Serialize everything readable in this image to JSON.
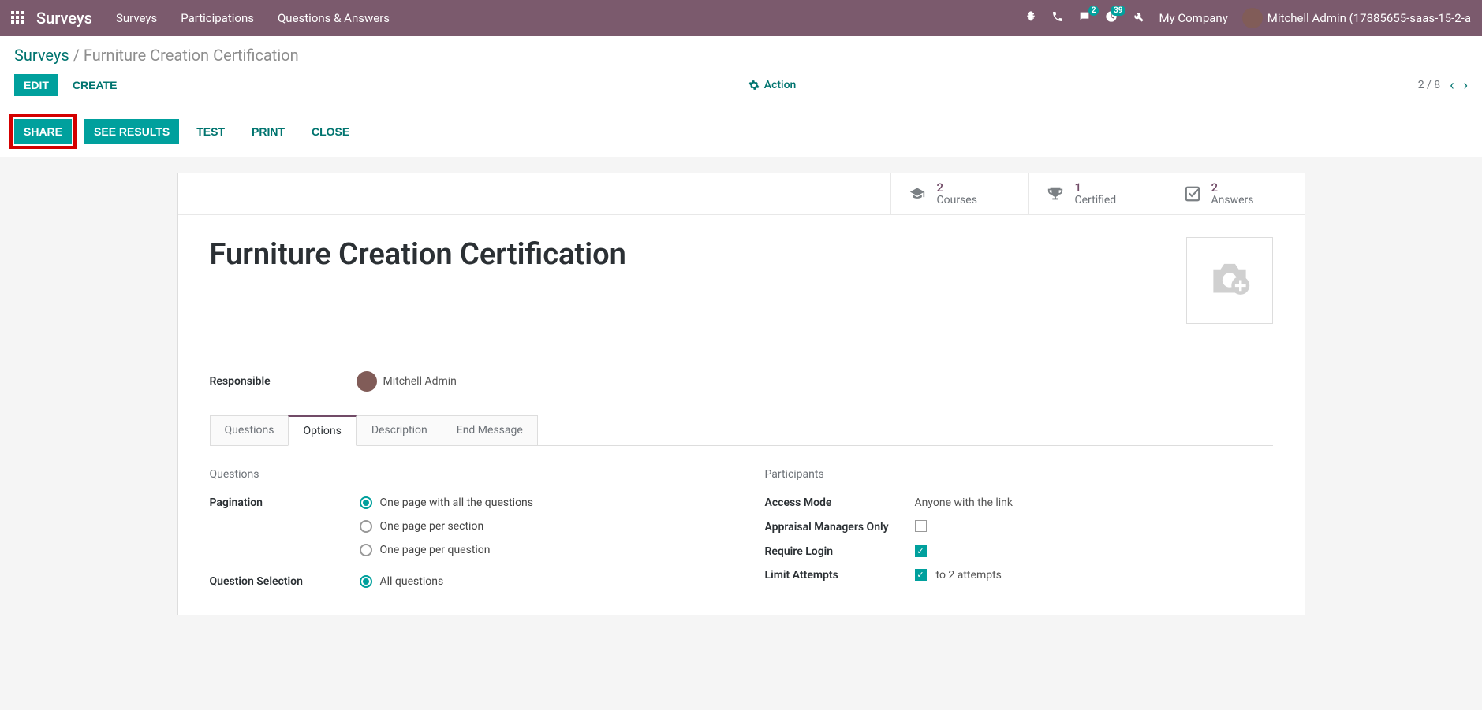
{
  "topnav": {
    "brand": "Surveys",
    "menu": [
      "Surveys",
      "Participations",
      "Questions & Answers"
    ],
    "chat_badge": "2",
    "activity_badge": "39",
    "company": "My Company",
    "user": "Mitchell Admin (17885655-saas-15-2-a"
  },
  "breadcrumb": {
    "root": "Surveys",
    "sep": " / ",
    "current": "Furniture Creation Certification"
  },
  "controls": {
    "edit": "EDIT",
    "create": "CREATE",
    "action": "Action",
    "pager": "2 / 8"
  },
  "statusbar": {
    "share": "SHARE",
    "see_results": "SEE RESULTS",
    "test": "TEST",
    "print": "PRINT",
    "close": "CLOSE"
  },
  "stats": {
    "courses": {
      "n": "2",
      "label": "Courses"
    },
    "certified": {
      "n": "1",
      "label": "Certified"
    },
    "answers": {
      "n": "2",
      "label": "Answers"
    }
  },
  "record": {
    "title": "Furniture Creation Certification",
    "responsible_label": "Responsible",
    "responsible": "Mitchell Admin"
  },
  "tabs": [
    "Questions",
    "Options",
    "Description",
    "End Message"
  ],
  "options": {
    "questions_hd": "Questions",
    "participants_hd": "Participants",
    "pagination_label": "Pagination",
    "pagination_opts": [
      "One page with all the questions",
      "One page per section",
      "One page per question"
    ],
    "qselection_label": "Question Selection",
    "qselection_opt": "All questions",
    "access_mode_label": "Access Mode",
    "access_mode": "Anyone with the link",
    "appraisal_label": "Appraisal Managers Only",
    "require_login_label": "Require Login",
    "limit_label": "Limit Attempts",
    "limit_value": "to 2 attempts"
  }
}
